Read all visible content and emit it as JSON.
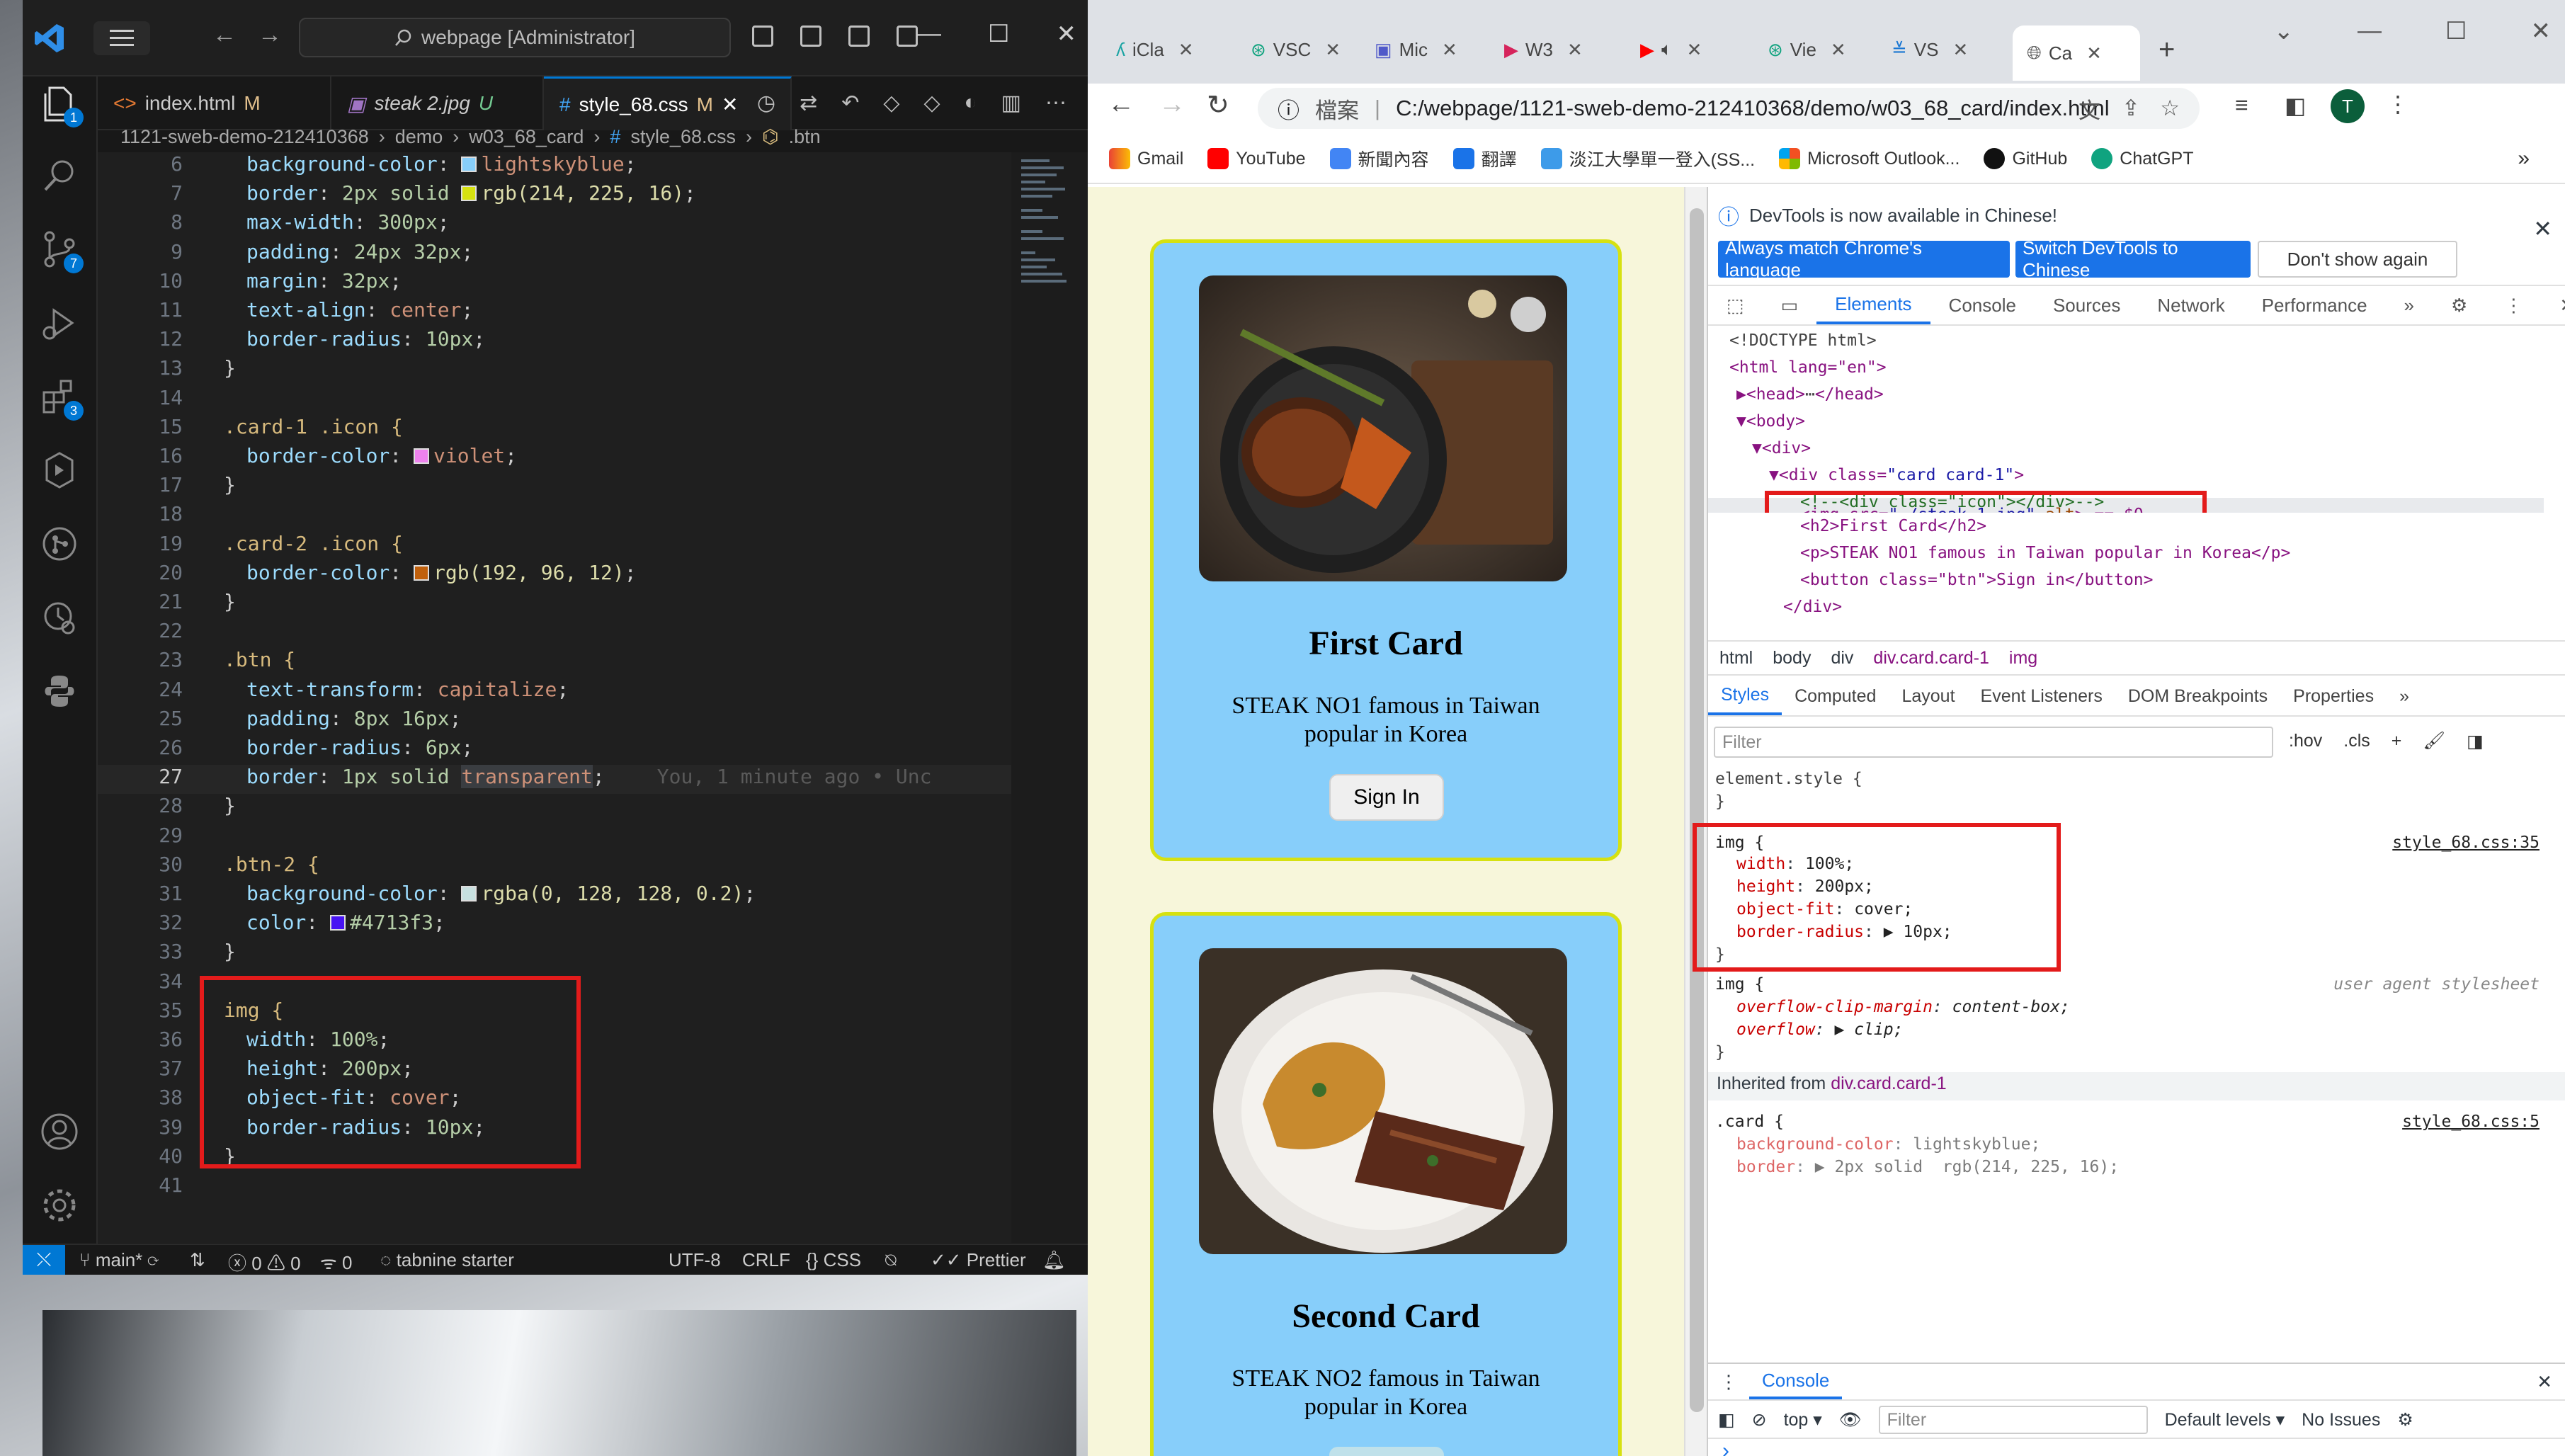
{
  "vscode": {
    "search": "webpage [Administrator]",
    "tabs": [
      {
        "label": "index.html",
        "mark": "M"
      },
      {
        "label": "steak 2.jpg",
        "mark": "U"
      },
      {
        "label": "style_68.css",
        "mark": "M"
      }
    ],
    "breadcrumb": [
      "1121-sweb-demo-212410368",
      "demo",
      "w03_68_card",
      "style_68.css",
      ".btn"
    ],
    "activity_badges": {
      "explorer": "1",
      "scm": "7",
      "extensions": "3"
    },
    "code": [
      {
        "n": "6",
        "sel": "",
        "prop": "background-color",
        "swatch": "#87cefa",
        "val": "lightskyblue",
        "end": ";"
      },
      {
        "n": "7",
        "sel": "",
        "prop": "border",
        "pre": "2px solid ",
        "swatch": "#d6e110",
        "val": "rgb(214, 225, 16)",
        "end": ";"
      },
      {
        "n": "8",
        "sel": "",
        "prop": "max-width",
        "val": "300px",
        "end": ";"
      },
      {
        "n": "9",
        "sel": "",
        "prop": "padding",
        "val": "24px 32px",
        "end": ";"
      },
      {
        "n": "10",
        "sel": "",
        "prop": "margin",
        "val": "32px",
        "end": ";"
      },
      {
        "n": "11",
        "sel": "",
        "prop": "text-align",
        "val": "center",
        "end": ";"
      },
      {
        "n": "12",
        "sel": "",
        "prop": "border-radius",
        "val": "10px",
        "end": ";"
      },
      {
        "n": "13",
        "text": "}"
      },
      {
        "n": "14",
        "text": ""
      },
      {
        "n": "15",
        "text": ".card-1 .icon {"
      },
      {
        "n": "16",
        "sel": "",
        "prop": "border-color",
        "swatch": "#ee82ee",
        "val": "violet",
        "end": ";"
      },
      {
        "n": "17",
        "text": "}"
      },
      {
        "n": "18",
        "text": ""
      },
      {
        "n": "19",
        "text": ".card-2 .icon {"
      },
      {
        "n": "20",
        "sel": "",
        "prop": "border-color",
        "swatch": "#c0600c",
        "val": "rgb(192, 96, 12)",
        "end": ";"
      },
      {
        "n": "21",
        "text": "}"
      },
      {
        "n": "22",
        "text": ""
      },
      {
        "n": "23",
        "text": ".btn {"
      },
      {
        "n": "24",
        "sel": "",
        "prop": "text-transform",
        "val": "capitalize",
        "end": ";"
      },
      {
        "n": "25",
        "sel": "",
        "prop": "padding",
        "val": "8px 16px",
        "end": ";"
      },
      {
        "n": "26",
        "sel": "",
        "prop": "border-radius",
        "val": "6px",
        "end": ";"
      },
      {
        "n": "27",
        "sel": "",
        "prop": "border",
        "pre": "1px solid ",
        "val": "transparent",
        "end": ";",
        "blame": "You, 1 minute ago • Unc"
      },
      {
        "n": "28",
        "text": "}"
      },
      {
        "n": "29",
        "text": ""
      },
      {
        "n": "30",
        "text": ".btn-2 {"
      },
      {
        "n": "31",
        "sel": "",
        "prop": "background-color",
        "swatch": "#c7e0e0",
        "val": "rgba(0, 128, 128, 0.2)",
        "end": ";"
      },
      {
        "n": "32",
        "sel": "",
        "prop": "color",
        "swatch": "#4713f3",
        "val": "#4713f3",
        "end": ";"
      },
      {
        "n": "33",
        "text": "}"
      },
      {
        "n": "34",
        "text": ""
      },
      {
        "n": "35",
        "text": "img {"
      },
      {
        "n": "36",
        "sel": "",
        "prop": "width",
        "val": "100%",
        "end": ";"
      },
      {
        "n": "37",
        "sel": "",
        "prop": "height",
        "val": "200px",
        "end": ";"
      },
      {
        "n": "38",
        "sel": "",
        "prop": "object-fit",
        "val": "cover",
        "end": ";"
      },
      {
        "n": "39",
        "sel": "",
        "prop": "border-radius",
        "val": "10px",
        "end": ";"
      },
      {
        "n": "40",
        "text": "}"
      },
      {
        "n": "41",
        "text": ""
      }
    ],
    "status": {
      "branch": "main*",
      "errors": "0",
      "warnings": "0",
      "ports": "0",
      "tabnine": "tabnine starter",
      "encoding": "UTF-8",
      "eol": "CRLF",
      "language": "CSS",
      "prettier": "Prettier"
    }
  },
  "chrome": {
    "tabs": [
      "iCla",
      "VSC",
      "Mic",
      "W3",
      "",
      "Vie",
      "VS",
      "Ca"
    ],
    "omnibox": {
      "secure_label": "檔案",
      "url": "C:/webpage/1121-sweb-demo-212410368/demo/w03_68_card/index.html"
    },
    "profile_initial": "T",
    "bookmarks": [
      "Gmail",
      "YouTube",
      "新聞內容",
      "翻譯",
      "淡江大學單一登入(SS...",
      "Microsoft Outlook...",
      "GitHub",
      "ChatGPT"
    ],
    "cards": [
      {
        "title": "First Card",
        "text": "STEAK NO1 famous in Taiwan popular in Korea",
        "button": "Sign In"
      },
      {
        "title": "Second Card",
        "text": "STEAK NO2 famous in Taiwan popular in Korea",
        "button": ""
      }
    ],
    "devtools": {
      "info": "DevTools is now available in Chinese!",
      "btn_match": "Always match Chrome's language",
      "btn_switch": "Switch DevTools to Chinese",
      "btn_dont": "Don't show again",
      "main_tabs": [
        "Elements",
        "Console",
        "Sources",
        "Network",
        "Performance"
      ],
      "dom": {
        "doctype": "<!DOCTYPE html>",
        "html": "<html lang=\"en\">",
        "head": "<head>",
        "head_close": "</head>",
        "body": "<body>",
        "div": "<div>",
        "card_div_tag": "<div class=",
        "card_div_val": "\"card card-1\"",
        "card_div_end": ">",
        "comment": "<!--<div class=\"icon\"></div>-->",
        "img_tag": "<img src=",
        "img_src": "\"./steak_1.jpg\"",
        "img_alt": " alt",
        "img_end": "> == $0",
        "h2": "<h2>First Card</h2>",
        "p": "<p>STEAK NO1 famous in Taiwan popular in Korea</p>",
        "button": "<button class=\"btn\">Sign in</button>",
        "div_close": "</div>"
      },
      "crumbs": [
        "html",
        "body",
        "div",
        "div.card.card-1",
        "img"
      ],
      "styles_tabs": [
        "Styles",
        "Computed",
        "Layout",
        "Event Listeners",
        "DOM Breakpoints",
        "Properties"
      ],
      "filter_placeholder": "Filter",
      "hov": ":hov",
      "cls": ".cls",
      "element_style": "element.style {",
      "close_brace": "}",
      "img_rule": {
        "selector": "img {",
        "source": "style_68.css:35",
        "props": [
          {
            "p": "width",
            "v": "100%;"
          },
          {
            "p": "height",
            "v": "200px;"
          },
          {
            "p": "object-fit",
            "v": "cover;"
          },
          {
            "p": "border-radius",
            "v": "▶ 10px;"
          }
        ]
      },
      "ua_rule": {
        "selector": "img {",
        "source": "user agent stylesheet",
        "props": [
          {
            "p": "overflow-clip-margin",
            "v": "content-box;"
          },
          {
            "p": "overflow",
            "v": "▶ clip;"
          }
        ]
      },
      "inherited": "Inherited from",
      "inherited_from": "div.card.card-1",
      "card_rule": {
        "selector": ".card {",
        "source": "style_68.css:5",
        "props": [
          {
            "p": "background-color",
            "v": "lightskyblue;"
          },
          {
            "p": "border",
            "v": "▶ 2px solid  rgb(214, 225, 16);"
          }
        ]
      },
      "console": {
        "label": "Console",
        "context": "top",
        "filter": "Filter",
        "levels": "Default levels",
        "issues": "No Issues",
        "prompt": "›"
      }
    }
  },
  "colors": {
    "card_bg": "#87cefa",
    "card_border": "#d6e110",
    "page_bg": "#f7f6da",
    "accent": "#1a73e8",
    "highlight": "#e31b1b"
  }
}
